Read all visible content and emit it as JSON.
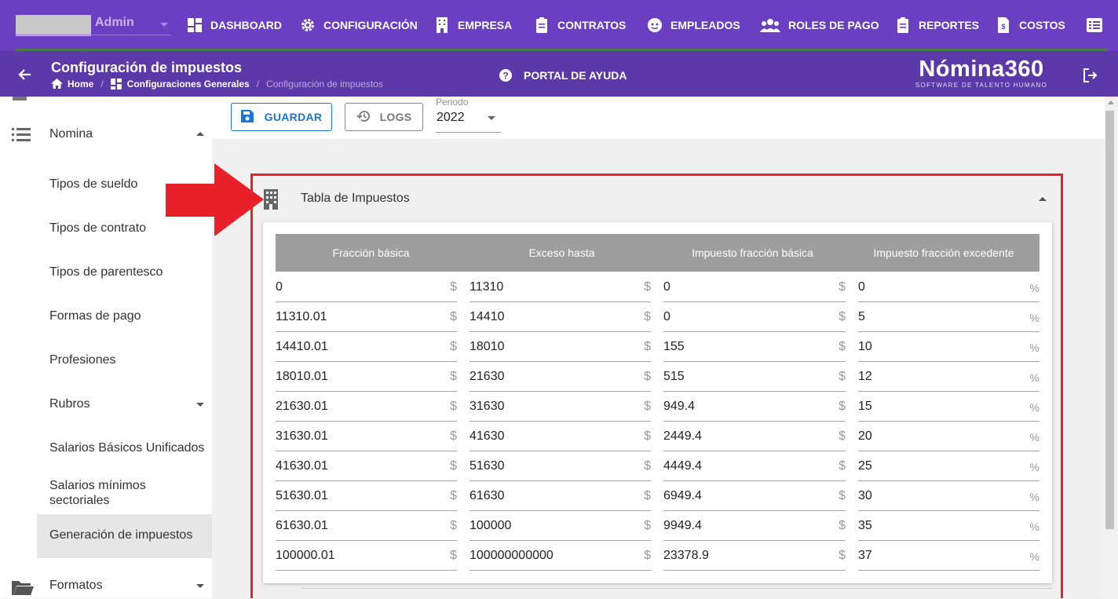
{
  "topnav": {
    "user": "Admin",
    "items": [
      {
        "label": "DASHBOARD",
        "icon": "dashboard-icon"
      },
      {
        "label": "CONFIGURACIÓN",
        "icon": "gear-icon"
      },
      {
        "label": "EMPRESA",
        "icon": "building-icon"
      },
      {
        "label": "CONTRATOS",
        "icon": "clipboard-icon"
      },
      {
        "label": "EMPLEADOS",
        "icon": "face-icon"
      },
      {
        "label": "ROLES DE PAGO",
        "icon": "group-icon"
      },
      {
        "label": "REPORTES",
        "icon": "clipboard-icon"
      },
      {
        "label": "COSTOS",
        "icon": "invoice-icon"
      }
    ]
  },
  "header": {
    "title": "Configuración de impuestos",
    "breadcrumb": [
      "Home",
      "Configuraciones Generales",
      "Configuración de impuestos"
    ],
    "help": "PORTAL DE AYUDA",
    "brand": "Nómina360",
    "brand_tag": "SOFTWARE DE TALENTO HUMANO"
  },
  "sidebar": {
    "section": "Nomina",
    "items": [
      "Tipos de sueldo",
      "Tipos de contrato",
      "Tipos de parentesco",
      "Formas de pago",
      "Profesiones",
      "Rubros",
      "Salarios Básicos Unificados",
      "Salarios mínimos sectoriales",
      "Generación de impuestos"
    ],
    "active": "Generación de impuestos",
    "next_section": "Formatos"
  },
  "toolbar": {
    "save_label": "GUARDAR",
    "logs_label": "LOGS",
    "periodo_label": "Periodo",
    "periodo_value": "2022"
  },
  "panel": {
    "title": "Tabla de Impuestos",
    "columns": [
      "Fracción básica",
      "Exceso hasta",
      "Impuesto fracción básica",
      "Impuesto fracción excedente"
    ],
    "units": [
      "$",
      "$",
      "$",
      "%"
    ],
    "rows": [
      [
        "0",
        "11310",
        "0",
        "0"
      ],
      [
        "11310.01",
        "14410",
        "0",
        "5"
      ],
      [
        "14410.01",
        "18010",
        "155",
        "10"
      ],
      [
        "18010.01",
        "21630",
        "515",
        "12"
      ],
      [
        "21630.01",
        "31630",
        "949.4",
        "15"
      ],
      [
        "31630.01",
        "41630",
        "2449.4",
        "20"
      ],
      [
        "41630.01",
        "51630",
        "4449.4",
        "25"
      ],
      [
        "51630.01",
        "61630",
        "6949.4",
        "30"
      ],
      [
        "61630.01",
        "100000",
        "9949.4",
        "35"
      ],
      [
        "100000.01",
        "100000000000",
        "23378.9",
        "37"
      ]
    ]
  },
  "colors": {
    "nav": "#6a3fc1",
    "subheader": "#5b39a8",
    "accent": "#1976d2",
    "highlight": "#e8202a"
  }
}
